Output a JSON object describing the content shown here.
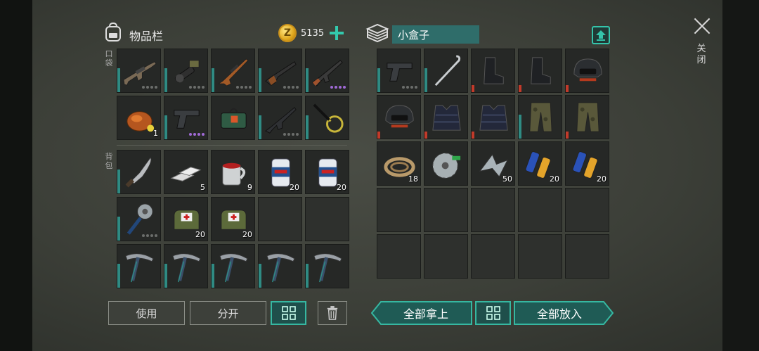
{
  "inventory": {
    "title": "物品栏",
    "coins": "5135",
    "coin_letter": "Z",
    "pocket_label": "口袋",
    "backpack_label": "背包",
    "slots": [
      {
        "icon": "scar-rifle-icon",
        "qty": "",
        "dots": "gray",
        "bar": "teal"
      },
      {
        "icon": "grenade-launcher-icon",
        "qty": "",
        "dots": "gray",
        "bar": "teal"
      },
      {
        "icon": "hunting-rifle-icon",
        "qty": "",
        "dots": "gray",
        "bar": "teal"
      },
      {
        "icon": "shotgun-icon",
        "qty": "",
        "dots": "gray",
        "bar": "teal"
      },
      {
        "icon": "ak-rifle-icon",
        "qty": "",
        "dots": "purple",
        "bar": "teal"
      },
      {
        "icon": "roast-chicken-icon",
        "qty": "1",
        "dots": "",
        "bar": ""
      },
      {
        "icon": "pistol-icon",
        "qty": "",
        "dots": "purple",
        "bar": "teal"
      },
      {
        "icon": "explosive-charge-icon",
        "qty": "",
        "dots": "",
        "bar": ""
      },
      {
        "icon": "m4-rifle-icon",
        "qty": "",
        "dots": "gray",
        "bar": "teal"
      },
      {
        "icon": "bug-net-icon",
        "qty": "",
        "dots": "",
        "bar": "teal"
      },
      {
        "icon": "machete-icon",
        "qty": "",
        "dots": "",
        "bar": "teal"
      },
      {
        "icon": "metal-ingots-icon",
        "qty": "5",
        "dots": "",
        "bar": ""
      },
      {
        "icon": "red-mug-icon",
        "qty": "9",
        "dots": "",
        "bar": ""
      },
      {
        "icon": "soda-can-icon",
        "qty": "20",
        "dots": "",
        "bar": ""
      },
      {
        "icon": "soda-can-icon",
        "qty": "20",
        "dots": "",
        "bar": ""
      },
      {
        "icon": "sawblade-mace-icon",
        "qty": "",
        "dots": "gray",
        "bar": "teal"
      },
      {
        "icon": "medkit-bag-icon",
        "qty": "20",
        "dots": "",
        "bar": ""
      },
      {
        "icon": "medkit-bag-icon",
        "qty": "20",
        "dots": "",
        "bar": ""
      },
      {
        "icon": "",
        "qty": "",
        "dots": "",
        "bar": ""
      },
      {
        "icon": "",
        "qty": "",
        "dots": "",
        "bar": ""
      },
      {
        "icon": "pickaxe-icon",
        "qty": "",
        "dots": "",
        "bar": "teal"
      },
      {
        "icon": "pickaxe-icon",
        "qty": "",
        "dots": "",
        "bar": "teal"
      },
      {
        "icon": "pickaxe-icon",
        "qty": "",
        "dots": "",
        "bar": "teal"
      },
      {
        "icon": "pickaxe-icon",
        "qty": "",
        "dots": "",
        "bar": "teal"
      },
      {
        "icon": "pickaxe-icon",
        "qty": "",
        "dots": "",
        "bar": "teal"
      }
    ],
    "buttons": {
      "use": "使用",
      "split": "分开"
    }
  },
  "box": {
    "title": "小盒子",
    "slots": [
      {
        "icon": "pistol-icon",
        "qty": "",
        "dots": "gray",
        "bar": "teal"
      },
      {
        "icon": "crowbar-icon",
        "qty": "",
        "dots": "",
        "bar": "teal"
      },
      {
        "icon": "boots-icon",
        "qty": "",
        "dots": "",
        "bar": "red"
      },
      {
        "icon": "boots-icon",
        "qty": "",
        "dots": "",
        "bar": "red"
      },
      {
        "icon": "helmet-icon",
        "qty": "",
        "dots": "",
        "bar": "red"
      },
      {
        "icon": "helmet-icon",
        "qty": "",
        "dots": "",
        "bar": "red"
      },
      {
        "icon": "armor-vest-icon",
        "qty": "",
        "dots": "",
        "bar": "red"
      },
      {
        "icon": "armor-vest-icon",
        "qty": "",
        "dots": "",
        "bar": "red"
      },
      {
        "icon": "camo-pants-icon",
        "qty": "",
        "dots": "",
        "bar": "teal"
      },
      {
        "icon": "camo-pants-icon",
        "qty": "",
        "dots": "",
        "bar": "red"
      },
      {
        "icon": "rope-icon",
        "qty": "18",
        "dots": "",
        "bar": ""
      },
      {
        "icon": "saw-blade-icon",
        "qty": "",
        "dots": "",
        "bar": ""
      },
      {
        "icon": "metal-scrap-icon",
        "qty": "50",
        "dots": "",
        "bar": ""
      },
      {
        "icon": "batteries-icon",
        "qty": "20",
        "dots": "",
        "bar": ""
      },
      {
        "icon": "batteries-icon",
        "qty": "20",
        "dots": "",
        "bar": ""
      }
    ],
    "buttons": {
      "take_all": "全部拿上",
      "put_all": "全部放入"
    }
  },
  "close_label": "关闭",
  "colors": {
    "accent": "#36b7a1",
    "durability": "#2f8b83",
    "broken": "#c23a2a",
    "panel": "#3c3f38"
  }
}
